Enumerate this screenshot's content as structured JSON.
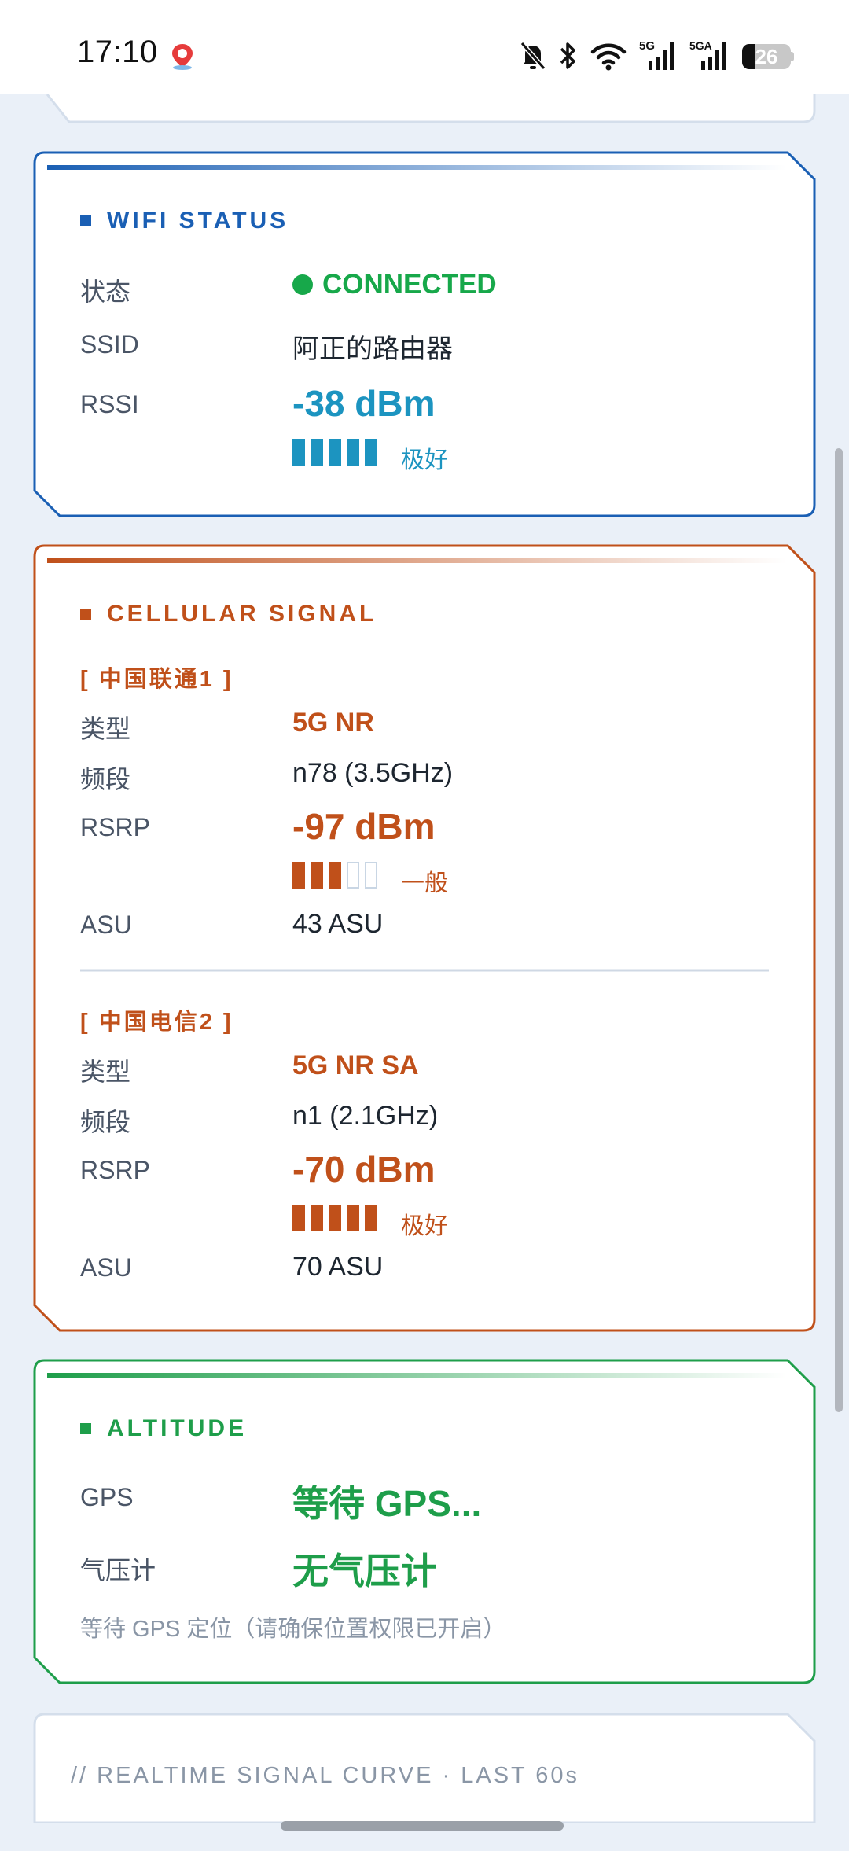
{
  "status_bar": {
    "time": "17:10",
    "battery": "26",
    "battery_level": 0.26,
    "icons": [
      "du-maps-app-icon",
      "mute-bell-icon",
      "bluetooth-icon",
      "wifi-icon",
      "5g-signal-icon",
      "5ga-signal-icon",
      "battery-icon"
    ]
  },
  "wifi": {
    "title": "WIFI STATUS",
    "status_label": "状态",
    "status_value": "CONNECTED",
    "ssid_label": "SSID",
    "ssid_value": "阿正的路由器",
    "rssi_label": "RSSI",
    "rssi_value": "-38 dBm",
    "rssi_quality": "极好",
    "rssi_bars_filled": 5,
    "accent": "#1a5fb4",
    "value_color": "#1c94c0"
  },
  "cellular": {
    "title": "CELLULAR SIGNAL",
    "accent": "#c0501a",
    "sims": [
      {
        "header": "[ 中国联通1 ]",
        "type_label": "类型",
        "type_value": "5G NR",
        "band_label": "频段",
        "band_value": "n78 (3.5GHz)",
        "rsrp_label": "RSRP",
        "rsrp_value": "-97 dBm",
        "rsrp_quality": "一般",
        "rsrp_bars_filled": 3,
        "asu_label": "ASU",
        "asu_value": "43 ASU"
      },
      {
        "header": "[ 中国电信2 ]",
        "type_label": "类型",
        "type_value": "5G NR SA",
        "band_label": "频段",
        "band_value": "n1 (2.1GHz)",
        "rsrp_label": "RSRP",
        "rsrp_value": "-70 dBm",
        "rsrp_quality": "极好",
        "rsrp_bars_filled": 5,
        "asu_label": "ASU",
        "asu_value": "70 ASU"
      }
    ]
  },
  "altitude": {
    "title": "ALTITUDE",
    "accent": "#1e9e4a",
    "gps_label": "GPS",
    "gps_value": "等待 GPS...",
    "baro_label": "气压计",
    "baro_value": "无气压计",
    "note": "等待 GPS 定位（请确保位置权限已开启）"
  },
  "curve": {
    "title": "// REALTIME SIGNAL CURVE · LAST 60s"
  }
}
